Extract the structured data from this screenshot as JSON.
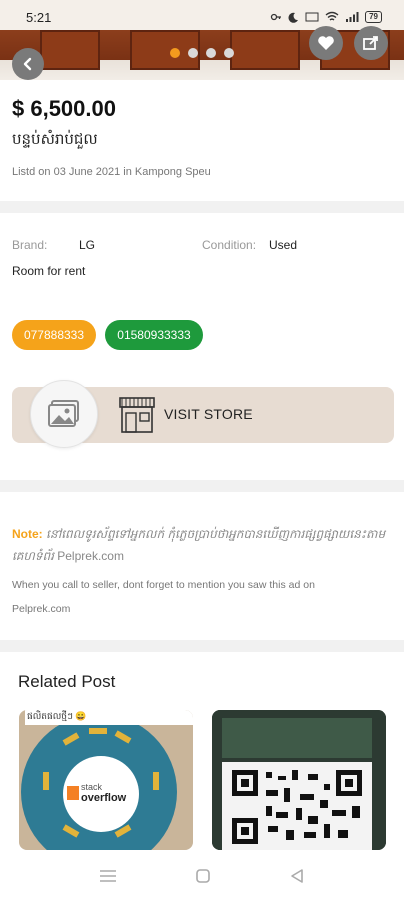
{
  "status_bar": {
    "time": "5:21",
    "battery": "79"
  },
  "hero": {
    "image_count": 4,
    "active_index": 0
  },
  "listing": {
    "price": "$ 6,500.00",
    "title": "បន្ទប់សំរាប់ជួល",
    "listed": "Listd on 03 June 2021 in Kampong Speu"
  },
  "details": {
    "brand_label": "Brand:",
    "brand_value": "LG",
    "condition_label": "Condition:",
    "condition_value": "Used",
    "category": "Room for rent"
  },
  "phones": [
    {
      "number": "077888333",
      "color": "#f5a31a"
    },
    {
      "number": "01580933333",
      "color": "#1e9a3c"
    }
  ],
  "store": {
    "label": "VISIT STORE"
  },
  "note": {
    "label": "Note:",
    "khmer_text": "នៅពេលទូរស័ព្ទទៅអ្នកលក់ កុំភ្លេចប្រាប់ថាអ្នកបានឃើញការផ្សព្វផ្សាយនេះតាមគេហទំព័រ",
    "site": "Pelprek.com",
    "english_text": "When you call to seller, dont forget to mention you saw this ad on",
    "english_site": "Pelprek.com"
  },
  "related": {
    "title": "Related Post",
    "cards": [
      {
        "caption": "ផលិតផលថ្មីៗ 😀",
        "logo_line1": "stack",
        "logo_line2": "overflow"
      },
      {
        "caption": ""
      }
    ]
  },
  "colors": {
    "accent": "#f5a31a",
    "green": "#1e9a3c",
    "store_bg": "#e7dcd2"
  }
}
